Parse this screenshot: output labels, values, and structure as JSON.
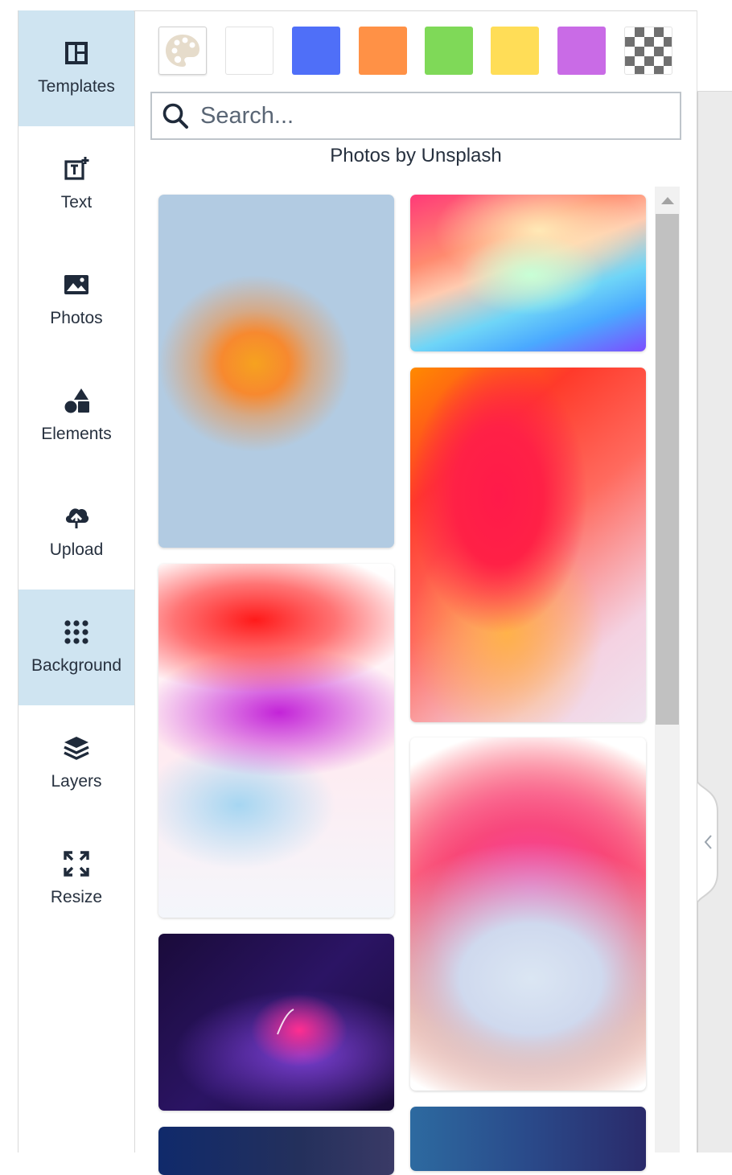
{
  "sidebar": {
    "items": [
      {
        "label": "Templates",
        "icon": "templates-icon",
        "active": true
      },
      {
        "label": "Text",
        "icon": "text-icon",
        "active": false
      },
      {
        "label": "Photos",
        "icon": "photos-icon",
        "active": false
      },
      {
        "label": "Elements",
        "icon": "elements-icon",
        "active": false
      },
      {
        "label": "Upload",
        "icon": "upload-icon",
        "active": false
      },
      {
        "label": "Background",
        "icon": "background-icon",
        "active": true
      },
      {
        "label": "Layers",
        "icon": "layers-icon",
        "active": false
      },
      {
        "label": "Resize",
        "icon": "resize-icon",
        "active": false
      }
    ],
    "active_color": "#cfe4f1"
  },
  "swatches": [
    {
      "name": "palette-picker",
      "color": "#ffffff"
    },
    {
      "name": "white",
      "color": "#ffffff"
    },
    {
      "name": "blue",
      "color": "#4f6ff8"
    },
    {
      "name": "orange",
      "color": "#ff9146"
    },
    {
      "name": "green",
      "color": "#7fd958"
    },
    {
      "name": "yellow",
      "color": "#ffdd57"
    },
    {
      "name": "purple",
      "color": "#c96be6"
    },
    {
      "name": "transparent",
      "color": "checker"
    }
  ],
  "search": {
    "placeholder": "Search..."
  },
  "photos": {
    "credit": "Photos by Unsplash"
  }
}
